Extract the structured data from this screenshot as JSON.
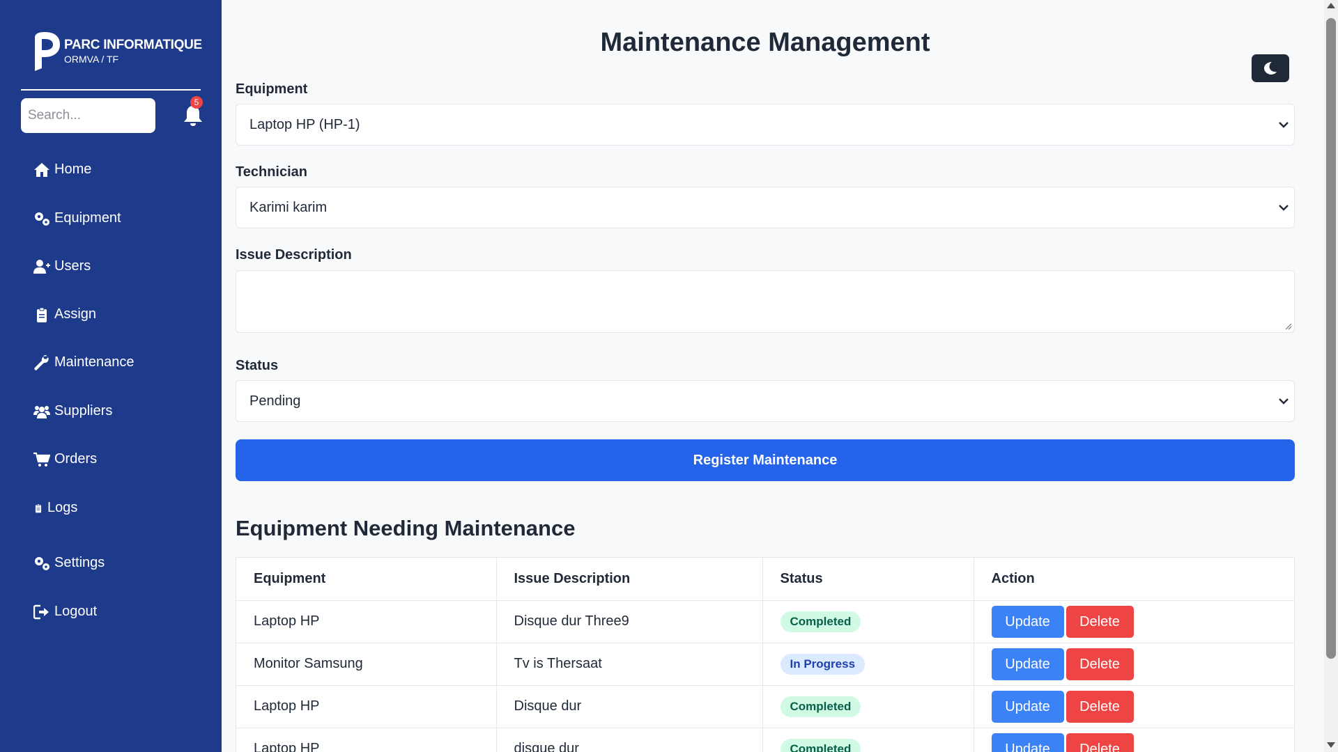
{
  "brand": {
    "title": "PARC INFORMATIQUE",
    "subtitle": "ORMVA / TF"
  },
  "search": {
    "placeholder": "Search..."
  },
  "notifications": {
    "count": "5"
  },
  "nav": [
    {
      "label": "Home",
      "icon": "home-icon"
    },
    {
      "label": "Equipment",
      "icon": "gears-icon"
    },
    {
      "label": "Users",
      "icon": "user-plus-icon"
    },
    {
      "label": "Assign",
      "icon": "clipboard-icon"
    },
    {
      "label": "Maintenance",
      "icon": "wrench-icon"
    },
    {
      "label": "Suppliers",
      "icon": "users-icon"
    },
    {
      "label": "Orders",
      "icon": "cart-icon"
    },
    {
      "label": "Logs",
      "icon": "clipboard-icon"
    },
    {
      "label": "Settings",
      "icon": "gears-icon"
    },
    {
      "label": "Logout",
      "icon": "logout-icon"
    }
  ],
  "page": {
    "title": "Maintenance Management"
  },
  "form": {
    "equipment_label": "Equipment",
    "equipment_value": "Laptop HP (HP-1)",
    "technician_label": "Technician",
    "technician_value": "Karimi karim",
    "issue_label": "Issue Description",
    "issue_value": "",
    "status_label": "Status",
    "status_value": "Pending",
    "submit_label": "Register Maintenance"
  },
  "table": {
    "title": "Equipment Needing Maintenance",
    "headers": [
      "Equipment",
      "Issue Description",
      "Status",
      "Action"
    ],
    "rows": [
      {
        "equipment": "Laptop HP",
        "issue": "Disque dur Three9",
        "status": "Completed"
      },
      {
        "equipment": "Monitor Samsung",
        "issue": "Tv is Thersaat",
        "status": "In Progress"
      },
      {
        "equipment": "Laptop HP",
        "issue": "Disque dur",
        "status": "Completed"
      },
      {
        "equipment": "Laptop HP",
        "issue": "disque dur",
        "status": "Completed"
      }
    ],
    "update_label": "Update",
    "delete_label": "Delete"
  },
  "colors": {
    "sidebar": "#1e3a8a",
    "primary": "#2563eb",
    "update": "#3b82f6",
    "delete": "#ef4444",
    "completed_bg": "#d1fae5",
    "in_progress_bg": "#dbeafe"
  }
}
